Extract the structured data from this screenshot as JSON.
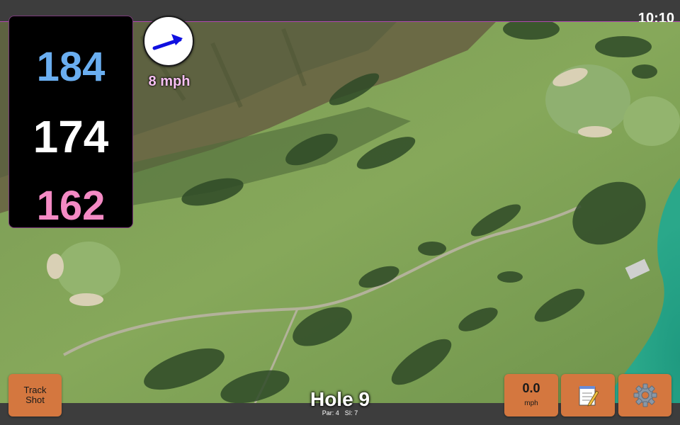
{
  "status": {
    "time": "10:10"
  },
  "distances": {
    "back": "184",
    "middle": "174",
    "front": "162"
  },
  "wind": {
    "speed_label": "8 mph",
    "direction_icon": "wind-arrow-icon"
  },
  "hole": {
    "title": "Hole 9",
    "par": "Par: 4",
    "si": "SI: 7"
  },
  "buttons": {
    "track_shot": "Track Shot",
    "speed_value": "0.0",
    "speed_unit": "mph",
    "notes_icon": "notepad-icon",
    "settings_icon": "gear-icon"
  },
  "colors": {
    "back_distance": "#6aaef0",
    "middle_distance": "#ffffff",
    "front_distance": "#f48ac4",
    "button_orange": "#d4773f",
    "wind_arrow": "#1010e0"
  }
}
